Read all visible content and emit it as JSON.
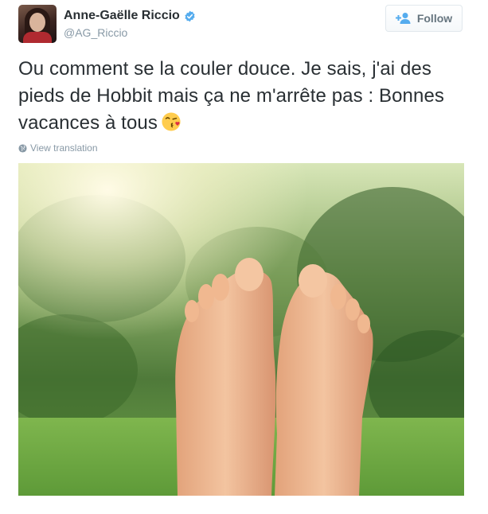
{
  "user": {
    "name": "Anne-Gaëlle Riccio",
    "handle": "@AG_Riccio",
    "verified": true
  },
  "follow_button": {
    "label": "Follow",
    "icon": "add-user-icon"
  },
  "tweet": {
    "text": "Ou comment se la couler douce. Je sais, j'ai des pieds de Hobbit mais ça ne m'arrête pas : Bonnes vacances à tous",
    "emoji": "face-throwing-kiss-icon"
  },
  "translate": {
    "label": "View translation",
    "icon": "globe-icon"
  },
  "colors": {
    "text": "#292f33",
    "muted": "#8899a6",
    "verified": "#55acee",
    "border": "#e1e8ed"
  }
}
